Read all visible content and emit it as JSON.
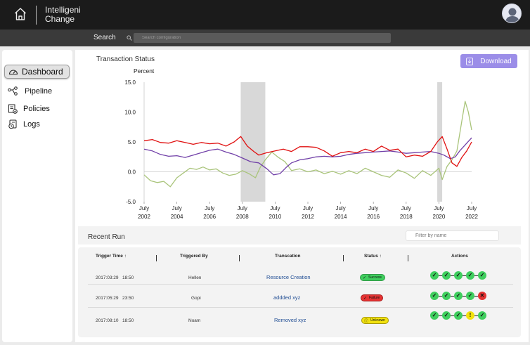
{
  "app": {
    "brand_line1": "Intelligeni",
    "brand_line2": "Change"
  },
  "search": {
    "label": "Search",
    "placeholder": "Search configuration"
  },
  "sidebar": {
    "items": [
      {
        "label": "Dashboard",
        "icon": "gauge-icon",
        "active": true
      },
      {
        "label": "Pipeline",
        "icon": "pipeline-icon"
      },
      {
        "label": "Policies",
        "icon": "policy-icon"
      },
      {
        "label": "Logs",
        "icon": "logs-icon"
      }
    ]
  },
  "chart_data": {
    "type": "line",
    "title": "Transaction Status",
    "ylabel": "Percent",
    "xlabel": "",
    "xlim": [
      2002.0,
      2022.0
    ],
    "ylim": [
      -5.0,
      15.0
    ],
    "y_ticks": [
      "15.0",
      "10.0",
      "5.0",
      "0.0",
      "-5.0"
    ],
    "x_ticks": [
      {
        "month": "July",
        "year": "2002"
      },
      {
        "month": "July",
        "year": "2004"
      },
      {
        "month": "July",
        "year": "2006"
      },
      {
        "month": "July",
        "year": "2008"
      },
      {
        "month": "July",
        "year": "2010"
      },
      {
        "month": "July",
        "year": "2012"
      },
      {
        "month": "July",
        "year": "2014"
      },
      {
        "month": "July",
        "year": "2016"
      },
      {
        "month": "July",
        "year": "2018"
      },
      {
        "month": "July",
        "year": "2020"
      },
      {
        "month": "July",
        "year": "2022"
      }
    ],
    "shaded_periods": [
      [
        2007.9,
        2009.4
      ],
      [
        2019.9,
        2020.2
      ]
    ],
    "grid": false,
    "series": [
      {
        "color": "#e01010",
        "x": [
          2002.0,
          2002.5,
          2003.0,
          2003.5,
          2004.0,
          2004.5,
          2005.0,
          2005.5,
          2006.0,
          2006.5,
          2007.0,
          2007.5,
          2007.9,
          2008.3,
          2008.7,
          2009.0,
          2009.5,
          2010.0,
          2010.5,
          2011.0,
          2011.5,
          2012.0,
          2012.5,
          2013.0,
          2013.5,
          2014.0,
          2014.5,
          2015.0,
          2015.5,
          2016.0,
          2016.5,
          2017.0,
          2017.5,
          2018.0,
          2018.5,
          2019.0,
          2019.5,
          2019.9,
          2020.2,
          2020.5,
          2020.8,
          2021.1,
          2021.4,
          2021.7,
          2022.0
        ],
        "values": [
          5.2,
          5.4,
          4.9,
          4.8,
          5.2,
          4.9,
          4.6,
          4.9,
          4.7,
          4.8,
          4.3,
          5.0,
          5.9,
          4.3,
          3.4,
          2.8,
          3.2,
          3.5,
          3.8,
          3.4,
          4.2,
          4.2,
          4.1,
          3.5,
          2.6,
          3.2,
          3.4,
          3.2,
          3.8,
          3.4,
          4.3,
          3.6,
          3.8,
          2.5,
          2.8,
          2.6,
          3.4,
          5.0,
          5.9,
          3.8,
          1.5,
          0.9,
          2.4,
          3.5,
          5.0
        ]
      },
      {
        "color": "#7140a8",
        "x": [
          2002.0,
          2002.5,
          2003.0,
          2003.5,
          2004.0,
          2004.5,
          2005.0,
          2005.5,
          2006.0,
          2006.5,
          2007.0,
          2007.5,
          2008.0,
          2008.5,
          2009.0,
          2009.5,
          2009.9,
          2010.3,
          2010.7,
          2011.0,
          2011.5,
          2012.0,
          2012.5,
          2013.0,
          2013.5,
          2014.0,
          2014.5,
          2015.0,
          2015.5,
          2016.0,
          2016.5,
          2017.0,
          2017.5,
          2018.0,
          2018.5,
          2019.0,
          2019.5,
          2020.0,
          2020.3,
          2020.7,
          2021.0,
          2021.3,
          2021.6,
          2022.0
        ],
        "values": [
          3.8,
          3.5,
          2.9,
          2.6,
          2.7,
          2.4,
          2.8,
          3.2,
          3.6,
          3.8,
          3.3,
          2.9,
          2.3,
          1.7,
          1.5,
          0.5,
          -0.5,
          -0.3,
          0.8,
          1.5,
          2.0,
          2.2,
          2.5,
          2.6,
          2.5,
          2.6,
          2.9,
          3.1,
          3.2,
          3.3,
          3.4,
          3.5,
          3.3,
          3.1,
          3.2,
          3.3,
          3.4,
          3.1,
          2.8,
          2.2,
          2.5,
          3.6,
          4.5,
          5.7
        ]
      },
      {
        "color": "#a9c47a",
        "x": [
          2002.0,
          2002.4,
          2002.8,
          2003.2,
          2003.6,
          2004.0,
          2004.4,
          2004.8,
          2005.2,
          2005.6,
          2006.0,
          2006.4,
          2006.8,
          2007.2,
          2007.6,
          2008.0,
          2008.4,
          2008.8,
          2009.1,
          2009.4,
          2009.8,
          2010.2,
          2010.6,
          2011.0,
          2011.5,
          2012.0,
          2012.5,
          2013.0,
          2013.5,
          2014.0,
          2014.5,
          2015.0,
          2015.5,
          2016.0,
          2016.5,
          2017.0,
          2017.5,
          2018.0,
          2018.5,
          2019.0,
          2019.5,
          2020.0,
          2020.2,
          2020.5,
          2020.8,
          2021.1,
          2021.4,
          2021.6,
          2021.8,
          2022.0
        ],
        "values": [
          -0.5,
          -1.5,
          -1.8,
          -1.6,
          -2.5,
          -1.0,
          -0.2,
          0.6,
          0.4,
          0.8,
          0.3,
          0.5,
          -0.2,
          -0.6,
          -0.4,
          0.2,
          -0.3,
          -1.0,
          0.8,
          2.0,
          3.3,
          2.4,
          1.7,
          0.2,
          0.5,
          0.0,
          0.3,
          -0.3,
          0.1,
          -0.4,
          0.2,
          -0.3,
          0.6,
          0.0,
          -0.6,
          -0.9,
          0.3,
          -0.2,
          -1.1,
          0.2,
          -0.6,
          0.6,
          -1.3,
          0.9,
          2.0,
          3.5,
          8.5,
          11.8,
          10.0,
          7.0
        ]
      }
    ]
  },
  "download_label": "Download",
  "recent": {
    "title": "Recent Run",
    "filter_placeholder": "Filter by name",
    "columns": [
      "Trigger Time ↑",
      "Triggered By",
      "Transcation",
      "Status ↑",
      "Actions"
    ],
    "rows": [
      {
        "time": "2017:03:29   18:50",
        "by": "Hellen",
        "transaction": "Resource Creation",
        "status": "Success",
        "status_icon": "check",
        "actions": [
          "ok",
          "ok",
          "ok",
          "ok",
          "ok"
        ]
      },
      {
        "time": "2017:05:29   23:50",
        "by": "Gopi",
        "transaction": "addded xyz",
        "status": "Failure",
        "status_icon": "check",
        "actions": [
          "ok",
          "ok",
          "ok",
          "ok",
          "fail"
        ]
      },
      {
        "time": "2017:08:10   18:50",
        "by": "Noam",
        "transaction": "Removed xyz",
        "status": "Unknown",
        "status_icon": "info",
        "actions": [
          "ok",
          "ok",
          "ok",
          "unknown",
          "ok"
        ]
      }
    ]
  },
  "colors": {
    "success": "#3fce5e",
    "failure": "#e43232",
    "unknown": "#f2e20e",
    "accent": "#9b8de8",
    "topbar": "#1b1b1b",
    "searchbar": "#3a3a3a"
  }
}
